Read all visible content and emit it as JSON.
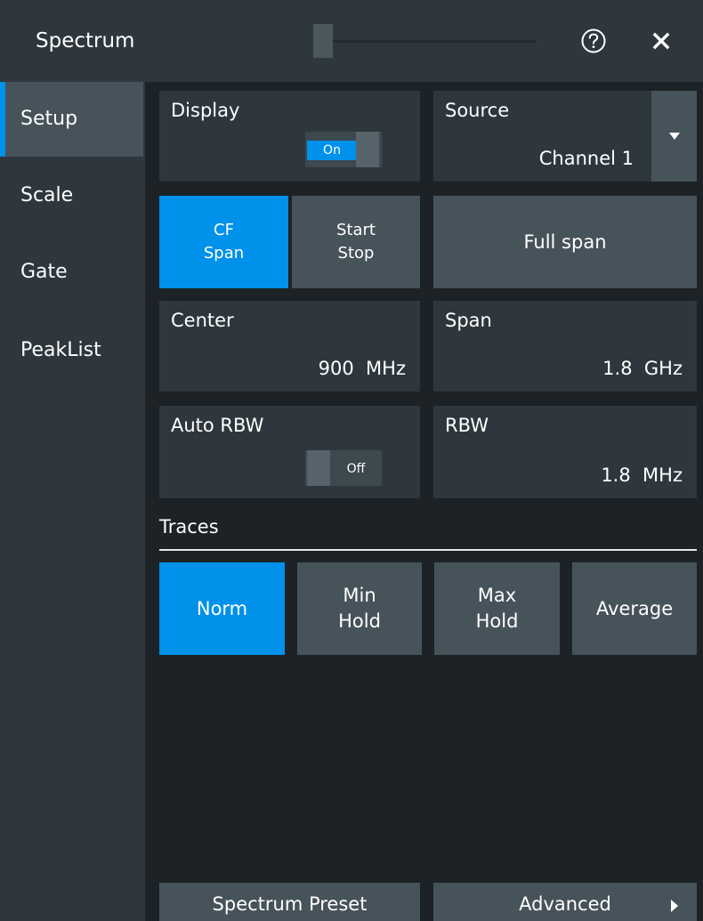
{
  "window": {
    "title": "Spectrum"
  },
  "tabs": [
    {
      "label": "Setup",
      "active": true
    },
    {
      "label": "Scale",
      "active": false
    },
    {
      "label": "Gate",
      "active": false
    },
    {
      "label": "PeakList",
      "active": false
    }
  ],
  "display": {
    "label": "Display",
    "state": "On"
  },
  "source": {
    "label": "Source",
    "value": "Channel 1"
  },
  "mode": {
    "cf_span": {
      "line1": "CF",
      "line2": "Span",
      "selected": true
    },
    "start_stop": {
      "line1": "Start",
      "line2": "Stop",
      "selected": false
    }
  },
  "full_span": {
    "label": "Full span"
  },
  "center": {
    "label": "Center",
    "value": "900  MHz"
  },
  "span": {
    "label": "Span",
    "value": "1.8  GHz"
  },
  "auto_rbw": {
    "label": "Auto RBW",
    "state": "Off"
  },
  "rbw": {
    "label": "RBW",
    "value": "1.8  MHz"
  },
  "traces": {
    "label": "Traces",
    "buttons": [
      {
        "line1": "Norm",
        "line2": "",
        "selected": true
      },
      {
        "line1": "Min",
        "line2": "Hold",
        "selected": false
      },
      {
        "line1": "Max",
        "line2": "Hold",
        "selected": false
      },
      {
        "line1": "Average",
        "line2": "",
        "selected": false
      }
    ]
  },
  "footer": {
    "preset": "Spectrum Preset",
    "advanced": "Advanced"
  },
  "colors": {
    "accent": "#0091ea",
    "panel": "#2e373d",
    "background": "#1c2226",
    "button": "#47535a"
  },
  "icons": {
    "help": "help-circle-icon",
    "close": "close-icon",
    "dropdown": "caret-down-icon",
    "more": "caret-right-icon"
  }
}
